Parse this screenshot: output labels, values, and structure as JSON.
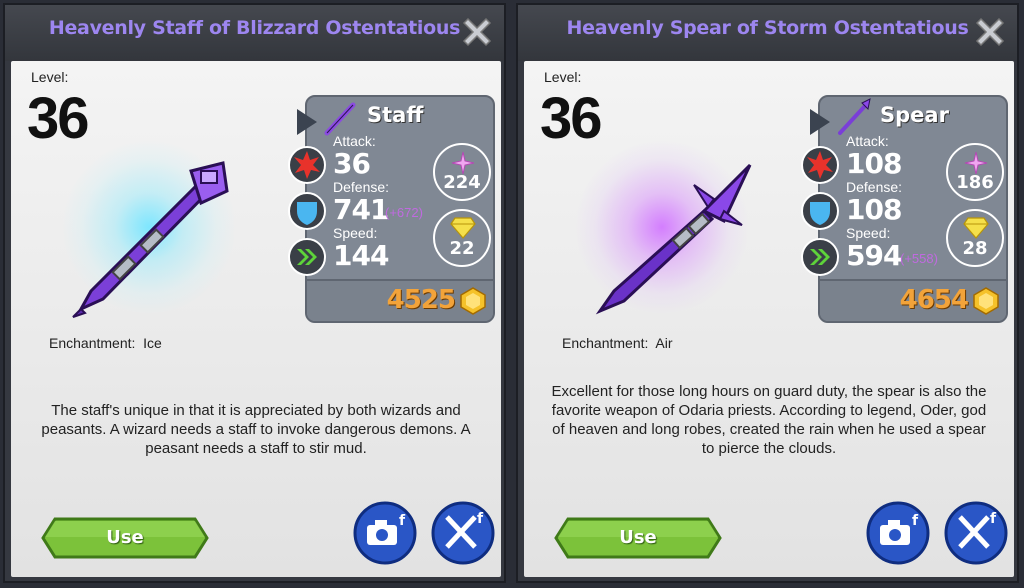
{
  "cards": [
    {
      "title": "Heavenly Staff of Blizzard Ostentatious",
      "level_label": "Level:",
      "level": "36",
      "type": "Staff",
      "attack_label": "Attack:",
      "attack": "36",
      "defense_label": "Defense:",
      "defense": "741",
      "defense_bonus": "(+672)",
      "speed_label": "Speed:",
      "speed": "144",
      "speed_bonus": "",
      "pink_gems": "224",
      "yellow_gems": "22",
      "price": "4525",
      "enchantment_label": "Enchantment:",
      "enchantment": "Ice",
      "description": "The staff's unique in that it is appreciated by both wizards and peasants. A wizard needs a staff to invoke dangerous demons. A peasant needs a staff to stir mud.",
      "use_label": "Use",
      "glow_color": "#7ae6ff"
    },
    {
      "title": "Heavenly Spear of Storm Ostentatious",
      "level_label": "Level:",
      "level": "36",
      "type": "Spear",
      "attack_label": "Attack:",
      "attack": "108",
      "defense_label": "Defense:",
      "defense": "108",
      "defense_bonus": "",
      "speed_label": "Speed:",
      "speed": "594",
      "speed_bonus": "(+558)",
      "pink_gems": "186",
      "yellow_gems": "28",
      "price": "4654",
      "enchantment_label": "Enchantment:",
      "enchantment": "Air",
      "description": "Excellent for those long hours on guard duty, the spear is also the favorite weapon of Odaria priests. According to legend, Oder, god of heaven and long robes, created the rain when he used a spear to pierce the clouds.",
      "use_label": "Use",
      "glow_color": "#d27aff"
    }
  ],
  "icons": {
    "close": "close-x-icon",
    "attack": "red-starburst-icon",
    "defense": "blue-shield-icon",
    "speed": "green-chevrons-icon",
    "pink_gem": "pink-star-gem-icon",
    "yellow_gem": "yellow-diamond-gem-icon",
    "coin": "gold-coin-icon",
    "screenshot_share": "camera-facebook-icon",
    "battle_share": "crossed-swords-facebook-icon"
  },
  "colors": {
    "title": "#9d86f0",
    "price": "#f2a33a",
    "bonus": "#c06ae0",
    "use_button": "#7cc23a"
  }
}
